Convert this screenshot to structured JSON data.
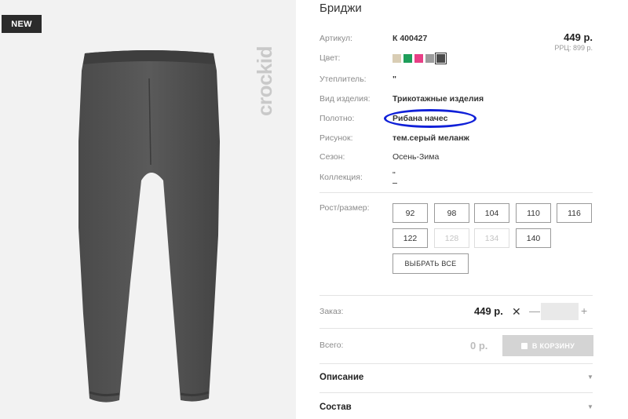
{
  "photo": {
    "badge": "NEW",
    "brand": "crockid"
  },
  "product": {
    "title": "Бриджи",
    "price": "449 р.",
    "rrp": "РРЦ: 899 р."
  },
  "specs": [
    {
      "label": "Артикул:",
      "value": "К 400427"
    },
    {
      "label": "Цвет:",
      "value": ""
    },
    {
      "label": "Утеплитель:",
      "value": "\""
    },
    {
      "label": "Вид изделия:",
      "value": "Трикотажные изделия"
    },
    {
      "label": "Полотно:",
      "value": "Рибана начес"
    },
    {
      "label": "Рисунок:",
      "value": "тем.серый меланж"
    },
    {
      "label": "Сезон:",
      "value": "Осень-Зима"
    },
    {
      "label": "Коллекция:",
      "value": "\""
    }
  ],
  "colors": [
    "#d9cdb4",
    "#1e9e5a",
    "#e83f86",
    "#9c9c9c",
    "#4a4a4a"
  ],
  "selected_color_index": 4,
  "sizes": {
    "label": "Рост/размер:",
    "items": [
      {
        "value": "92",
        "available": true
      },
      {
        "value": "98",
        "available": true
      },
      {
        "value": "104",
        "available": true
      },
      {
        "value": "110",
        "available": true
      },
      {
        "value": "116",
        "available": true
      },
      {
        "value": "122",
        "available": true
      },
      {
        "value": "128",
        "available": false
      },
      {
        "value": "134",
        "available": false
      },
      {
        "value": "140",
        "available": true
      }
    ],
    "select_all": "ВЫБРАТЬ ВСЕ"
  },
  "order": {
    "label": "Заказ:",
    "price": "449 р.",
    "times": "✕",
    "minus": "—",
    "plus": "+",
    "quantity": ""
  },
  "total": {
    "label": "Всего:",
    "value": "0 р.",
    "cart_button": "В КОРЗИНУ"
  },
  "accordion": [
    {
      "label": "Описание"
    },
    {
      "label": "Состав"
    }
  ],
  "annotation_color": "#1020d8"
}
